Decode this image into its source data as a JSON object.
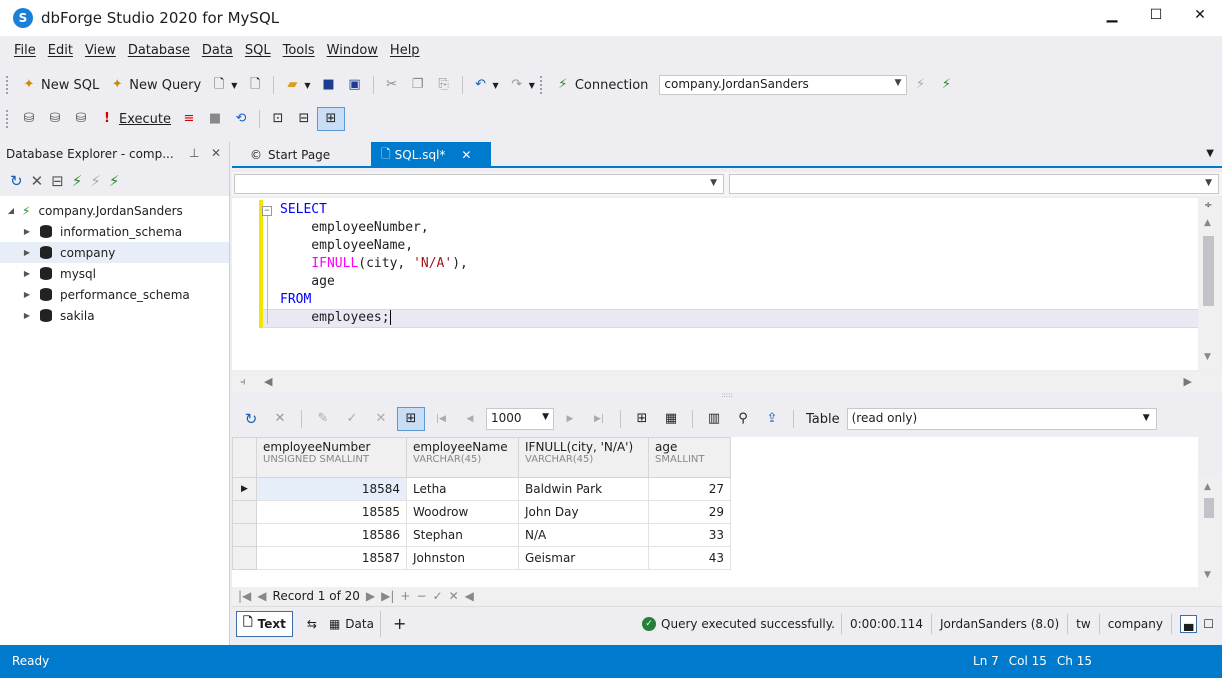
{
  "window": {
    "title": "dbForge Studio 2020 for MySQL",
    "logo_glyph": "S",
    "minimize": "▁",
    "maximize": "☐",
    "close": "✕"
  },
  "menu": [
    "File",
    "Edit",
    "View",
    "Database",
    "Data",
    "SQL",
    "Tools",
    "Window",
    "Help"
  ],
  "toolbar1": {
    "new_sql": "New SQL",
    "new_query": "New Query",
    "connection_label": "Connection",
    "connection_value": "company.JordanSanders"
  },
  "toolbar2": {
    "execute": "Execute"
  },
  "explorer": {
    "title": "Database Explorer - comp...",
    "root": "company.JordanSanders",
    "databases": [
      "information_schema",
      "company",
      "mysql",
      "performance_schema",
      "sakila"
    ]
  },
  "tabs": {
    "start_page": "Start Page",
    "sql_tab": "SQL.sql*",
    "close": "✕"
  },
  "editor": {
    "lines": {
      "l1": "SELECT",
      "l2": "    employeeNumber,",
      "l3": "    employeeName,",
      "l4_fn": "IFNULL",
      "l4_open": "(city, ",
      "l4_str": "'N/A'",
      "l4_close": "),",
      "l5": "    age",
      "l6": "FROM",
      "l7": "    employees;"
    }
  },
  "grid_toolbar": {
    "page_size": "1000",
    "view_label": "Table",
    "view_value": "(read only)"
  },
  "grid": {
    "columns": [
      {
        "name": "employeeNumber",
        "type": "UNSIGNED SMALLINT"
      },
      {
        "name": "employeeName",
        "type": "VARCHAR(45)"
      },
      {
        "name": "IFNULL(city, 'N/A')",
        "type": "VARCHAR(45)"
      },
      {
        "name": "age",
        "type": "SMALLINT"
      }
    ],
    "rows": [
      {
        "number": "18584",
        "name": "Letha",
        "city": "Baldwin Park",
        "age": "27"
      },
      {
        "number": "18585",
        "name": "Woodrow",
        "city": "John Day",
        "age": "29"
      },
      {
        "number": "18586",
        "name": "Stephan",
        "city": "N/A",
        "age": "33"
      },
      {
        "number": "18587",
        "name": "Johnston",
        "city": "Geismar",
        "age": "43"
      }
    ],
    "record_nav": "Record 1 of 20"
  },
  "result_status": {
    "text_tab": "Text",
    "data_tab": "Data",
    "add": "+",
    "message": "Query executed successfully.",
    "duration": "0:00:00.114",
    "user": "JordanSanders (8.0)",
    "host": "tw",
    "database": "company"
  },
  "statusbar": {
    "state": "Ready",
    "ln": "Ln 7",
    "col": "Col 15",
    "ch": "Ch 15"
  },
  "colors": {
    "accent": "#007acc",
    "keyword": "#0000ff",
    "function": "#ff00ff",
    "string": "#a31515",
    "success": "#27803a"
  }
}
